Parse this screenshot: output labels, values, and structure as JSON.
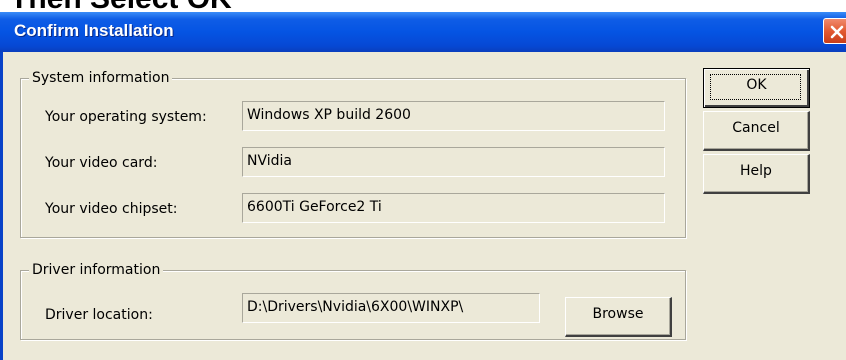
{
  "caption": {
    "text": "Then Select OK"
  },
  "window": {
    "title": "Confirm Installation",
    "close_icon": "close-x-icon"
  },
  "system_info": {
    "legend": "System information",
    "rows": [
      {
        "label": "Your operating system:",
        "value": "Windows XP  build 2600"
      },
      {
        "label": "Your video card:",
        "value": "NVidia"
      },
      {
        "label": "Your video chipset:",
        "value": "6600Ti GeForce2 Ti"
      }
    ]
  },
  "driver_info": {
    "legend": "Driver information",
    "location_label": "Driver location:",
    "location_value": "D:\\Drivers\\Nvidia\\6X00\\WINXP\\",
    "browse_label": "Browse"
  },
  "buttons": {
    "ok": "OK",
    "cancel": "Cancel",
    "help": "Help"
  },
  "colors": {
    "titlebar": "#0554e3",
    "dialog_bg": "#ece9d8",
    "close_button": "#e25a32"
  }
}
